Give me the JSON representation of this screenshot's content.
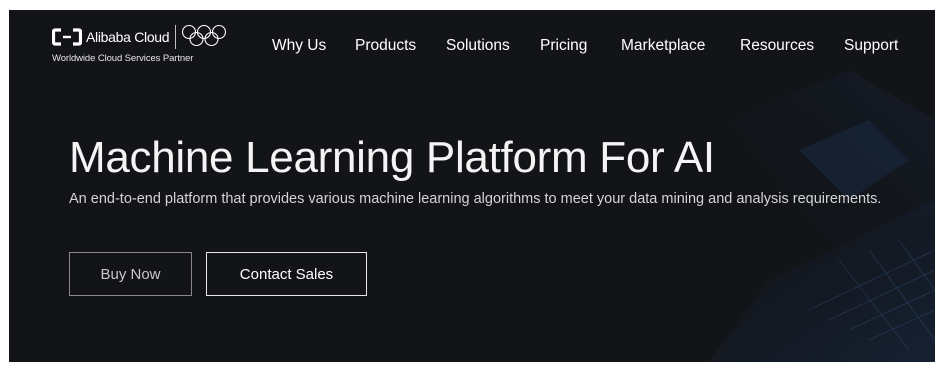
{
  "header": {
    "brand_name": "Alibaba Cloud",
    "tagline": "Worldwide Cloud Services Partner",
    "nav": [
      {
        "label": "Why Us"
      },
      {
        "label": "Products"
      },
      {
        "label": "Solutions"
      },
      {
        "label": "Pricing"
      },
      {
        "label": "Marketplace"
      },
      {
        "label": "Resources"
      },
      {
        "label": "Support"
      }
    ]
  },
  "hero": {
    "title": "Machine Learning Platform For AI",
    "description": "An end-to-end platform that provides various machine learning algorithms to meet your data mining and analysis requirements.",
    "buy_label": "Buy Now",
    "contact_label": "Contact Sales"
  },
  "icons": {
    "brand": "alibaba-cloud-logo-icon",
    "rings": "olympic-rings-icon"
  },
  "colors": {
    "background": "#121418",
    "text": "#ffffff",
    "accent_art": "#2a4a7a"
  }
}
